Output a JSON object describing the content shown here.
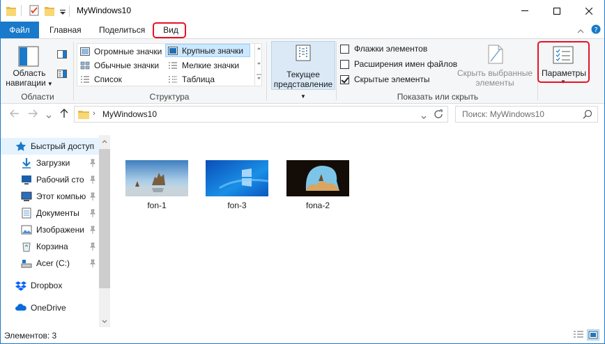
{
  "window": {
    "title": "MyWindows10",
    "minimize_glyph": "—",
    "maximize_glyph": "☐",
    "close_glyph": "✕"
  },
  "tabs": {
    "file": "Файл",
    "home": "Главная",
    "share": "Поделиться",
    "view": "Вид"
  },
  "ribbon": {
    "panes": {
      "nav_pane": "Область навигации",
      "group": "Области"
    },
    "layout": {
      "items": [
        "Огромные значки",
        "Крупные значки",
        "Обычные значки",
        "Мелкие значки",
        "Список",
        "Таблица"
      ],
      "selected": "Крупные значки",
      "group": "Структура"
    },
    "current_view": {
      "label": "Текущее представление"
    },
    "show_hide": {
      "checkboxes": [
        {
          "label": "Флажки элементов",
          "checked": false
        },
        {
          "label": "Расширения имен файлов",
          "checked": false
        },
        {
          "label": "Скрытые элементы",
          "checked": true
        }
      ],
      "hide_selected": "Скрыть выбранные элементы",
      "group": "Показать или скрыть"
    },
    "options": {
      "label": "Параметры"
    }
  },
  "address": {
    "path": "MyWindows10",
    "search_placeholder": "Поиск: MyWindows10"
  },
  "nav_pane": {
    "items": [
      {
        "label": "Быстрый доступ",
        "icon": "star-icon"
      },
      {
        "label": "Загрузки",
        "icon": "download-icon"
      },
      {
        "label": "Рабочий сто",
        "icon": "desktop-icon"
      },
      {
        "label": "Этот компью",
        "icon": "computer-icon"
      },
      {
        "label": "Документы",
        "icon": "documents-icon"
      },
      {
        "label": "Изображени",
        "icon": "pictures-icon"
      },
      {
        "label": "Корзина",
        "icon": "recycle-bin-icon"
      },
      {
        "label": "Acer (C:)",
        "icon": "drive-icon"
      },
      {
        "label": "Dropbox",
        "icon": "dropbox-icon"
      },
      {
        "label": "OneDrive",
        "icon": "onedrive-icon"
      }
    ]
  },
  "files": [
    {
      "name": "fon-1"
    },
    {
      "name": "fon-3"
    },
    {
      "name": "fona-2"
    }
  ],
  "status": {
    "text": "Элементов: 3"
  },
  "colors": {
    "accent": "#1979ca",
    "highlight": "#e81123",
    "selection": "#cce8ff"
  }
}
